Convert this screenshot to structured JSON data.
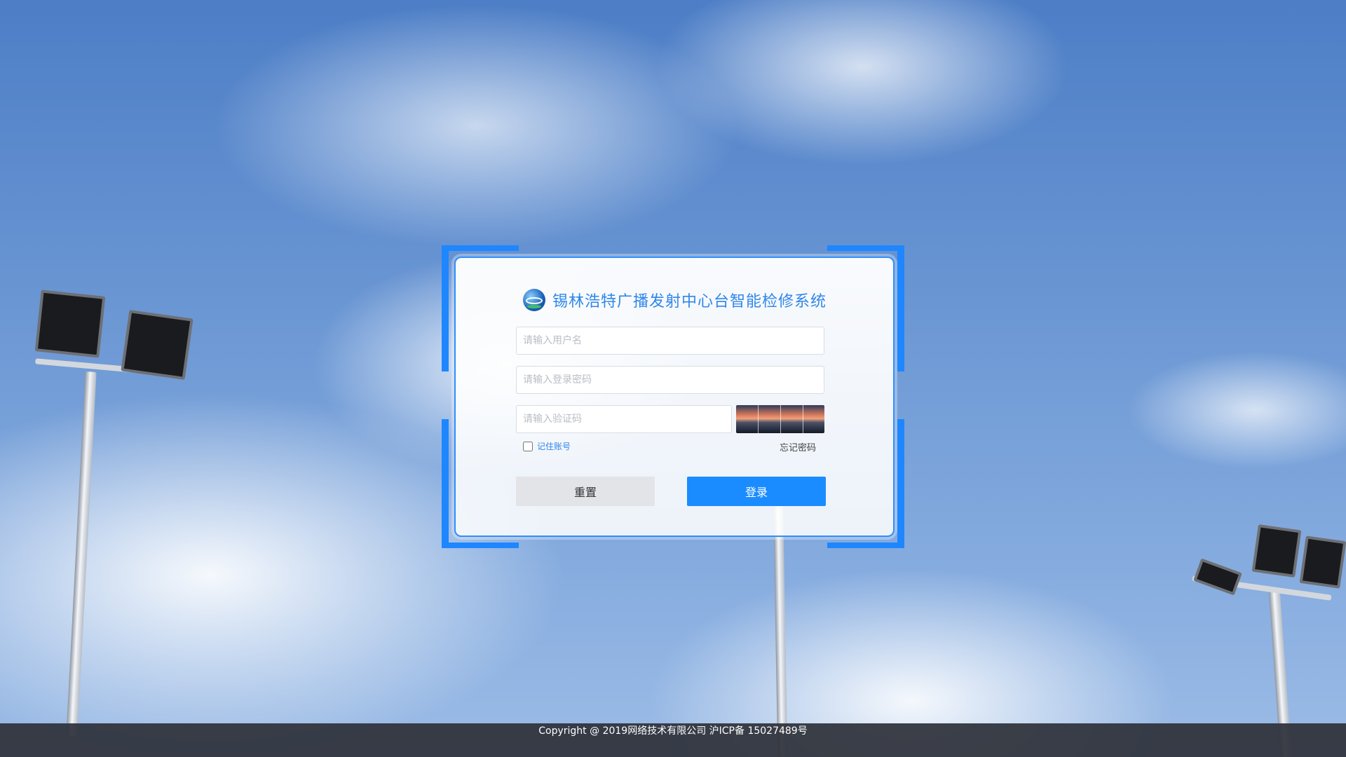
{
  "header": {
    "title": "锡林浩特广播发射中心台智能检修系统",
    "logo_icon": "broadcast-logo-icon"
  },
  "form": {
    "username": {
      "value": "",
      "placeholder": "请输入用户名"
    },
    "password": {
      "value": "",
      "placeholder": "请输入登录密码"
    },
    "captcha": {
      "value": "",
      "placeholder": "请输入验证码"
    },
    "remember_label": "记住账号",
    "forgot_label": "忘记密码",
    "reset_label": "重置",
    "login_label": "登录"
  },
  "footer": {
    "copyright": "Copyright @ 2019网络技术有限公司 沪ICP备 15027489号"
  },
  "colors": {
    "accent": "#1a8cff",
    "frame": "#1e86ff",
    "title": "#2f87ea",
    "footer_bg": "#2e323a"
  }
}
